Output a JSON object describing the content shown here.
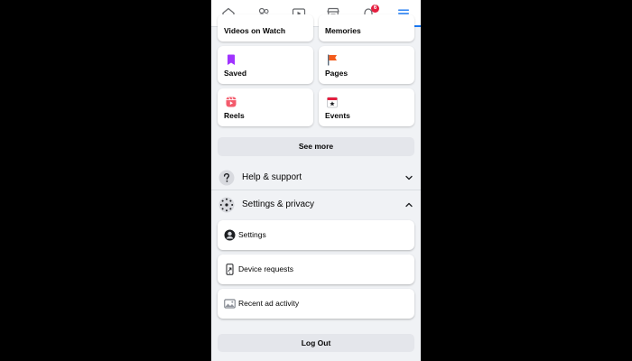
{
  "nav": {
    "tabs": [
      {
        "icon": "home-icon"
      },
      {
        "icon": "friends-icon"
      },
      {
        "icon": "watch-icon"
      },
      {
        "icon": "marketplace-icon"
      },
      {
        "icon": "notifications-icon",
        "badge": "6"
      },
      {
        "icon": "menu-icon",
        "active": true
      }
    ],
    "accent": "#1877f2"
  },
  "shortcuts": [
    {
      "label": "Videos on Watch",
      "icon": "watch-video-icon"
    },
    {
      "label": "Memories",
      "icon": "memories-icon"
    },
    {
      "label": "Saved",
      "icon": "saved-bookmark-icon",
      "color": "#a033ff"
    },
    {
      "label": "Pages",
      "icon": "pages-flag-icon",
      "color": "#f35b1b"
    },
    {
      "label": "Reels",
      "icon": "reels-icon",
      "color": "#f35b6c"
    },
    {
      "label": "Events",
      "icon": "events-calendar-icon",
      "color": "#e41e3f"
    }
  ],
  "see_more_label": "See more",
  "help": {
    "label": "Help & support",
    "icon": "help-question-icon"
  },
  "settings_privacy": {
    "label": "Settings & privacy",
    "icon": "gear-icon",
    "items": [
      {
        "label": "Settings",
        "icon": "account-icon"
      },
      {
        "label": "Device requests",
        "icon": "device-icon"
      },
      {
        "label": "Recent ad activity",
        "icon": "ad-activity-icon"
      }
    ]
  },
  "logout_label": "Log Out"
}
